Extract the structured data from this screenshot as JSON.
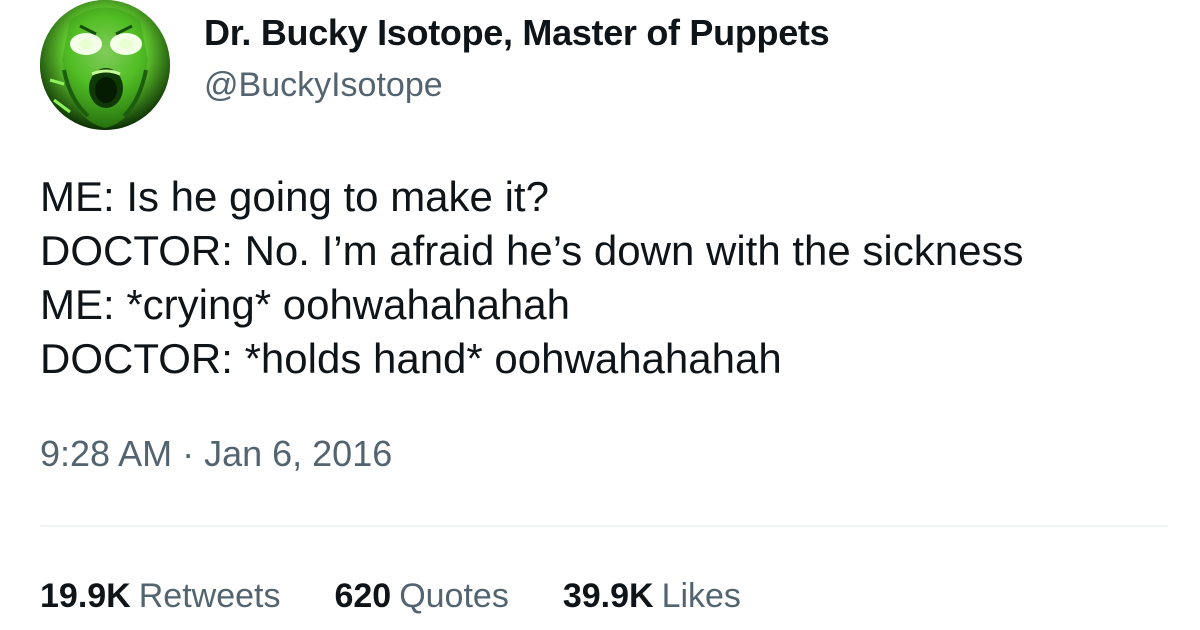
{
  "author": {
    "display_name": "Dr. Bucky Isotope, Master of Puppets",
    "handle": "@BuckyIsotope"
  },
  "tweet": {
    "lines": [
      "ME: Is he going to make it?",
      "DOCTOR: No. I’m afraid he’s down with the sickness",
      "ME: *crying* oohwahahahah",
      "DOCTOR: *holds hand* oohwahahahah"
    ],
    "timestamp": "9:28 AM · Jan 6, 2016"
  },
  "stats": {
    "retweets": {
      "count": "19.9K",
      "label": "Retweets"
    },
    "quotes": {
      "count": "620",
      "label": "Quotes"
    },
    "likes": {
      "count": "39.9K",
      "label": "Likes"
    }
  },
  "colors": {
    "primary_text": "#0f1419",
    "secondary_text": "#536471",
    "divider": "#eff3f4",
    "avatar_green": "#5bd62a"
  },
  "icons": {
    "avatar": "green-screaming-face-avatar"
  }
}
